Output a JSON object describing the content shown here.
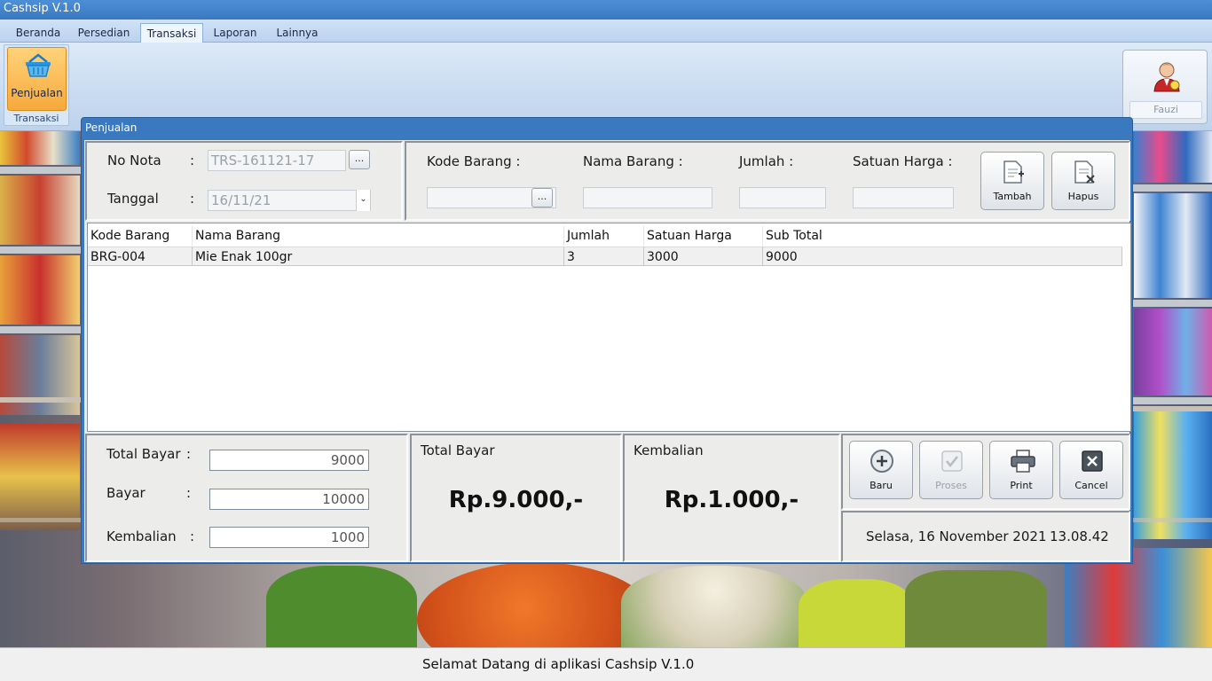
{
  "app": {
    "title": "Cashsip V.1.0"
  },
  "ribbon": {
    "tabs": [
      {
        "label": "Beranda"
      },
      {
        "label": "Persedian"
      },
      {
        "label": "Transaksi"
      },
      {
        "label": "Laporan"
      },
      {
        "label": "Lainnya"
      }
    ],
    "active_tab": "Transaksi",
    "penjualan_label": "Penjualan",
    "group_label": "Transaksi",
    "user_name": "Fauzi"
  },
  "dialog": {
    "title": "Penjualan",
    "no_nota_label": "No Nota",
    "colon": ":",
    "no_nota_value": "TRS-161121-17",
    "tanggal_label": "Tanggal",
    "tanggal_value": "16/11/21",
    "browse_label": "...",
    "kode_barang_label": "Kode Barang :",
    "nama_barang_label": "Nama Barang :",
    "jumlah_label": "Jumlah :",
    "satuan_harga_label": "Satuan Harga :",
    "tambah_label": "Tambah",
    "hapus_label": "Hapus"
  },
  "table": {
    "columns": [
      "Kode Barang",
      "Nama Barang",
      "Jumlah",
      "Satuan Harga",
      "Sub Total"
    ],
    "rows": [
      [
        "BRG-004",
        "Mie Enak 100gr",
        "3",
        "3000",
        "9000"
      ]
    ]
  },
  "payment": {
    "total_bayar_label": "Total Bayar",
    "total_bayar_value": "9000",
    "bayar_label": "Bayar",
    "bayar_value": "10000",
    "kembalian_label": "Kembalian",
    "kembalian_value": "1000",
    "total_caption": "Total Bayar",
    "total_display": "Rp.9.000,-",
    "kembalian_caption": "Kembalian",
    "kembalian_display": "Rp.1.000,-"
  },
  "actions": {
    "baru": "Baru",
    "proses": "Proses",
    "print": "Print",
    "cancel": "Cancel"
  },
  "datetime": {
    "date": "Selasa, 16 November 2021",
    "time": "13.08.42"
  },
  "status": {
    "message": "Selamat Datang di aplikasi Cashsip V.1.0"
  }
}
